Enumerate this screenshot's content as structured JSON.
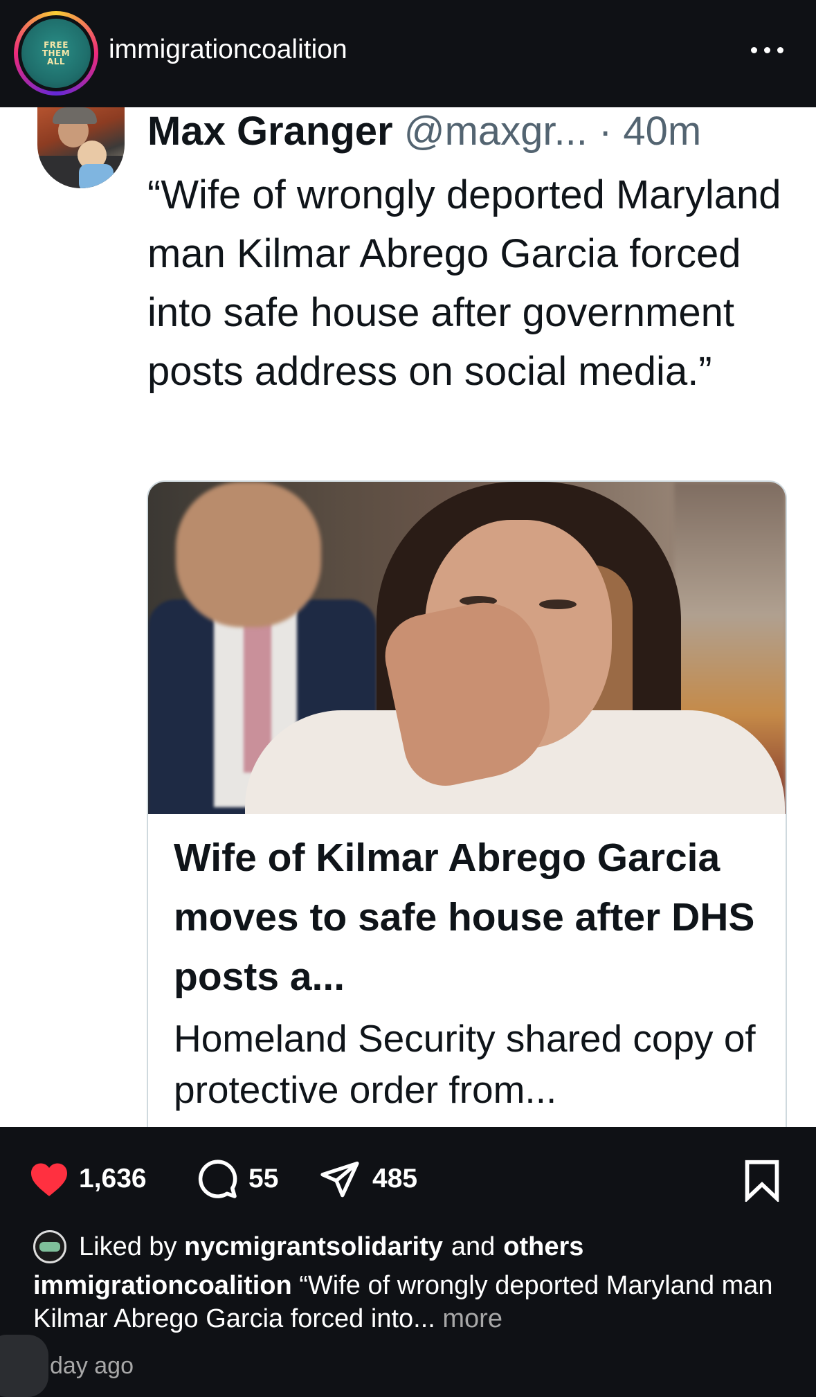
{
  "header": {
    "account_name": "immigrationcoalition",
    "avatar_text": [
      "FREE",
      "THEM",
      "ALL"
    ]
  },
  "tweet": {
    "author_name": "Max Granger",
    "author_handle": "@maxgr...",
    "separator": " · ",
    "time": "40m",
    "text": "“Wife of wrongly deported Maryland man Kilmar Abrego Garcia forced into safe house after government posts address on social media.”",
    "card": {
      "title": "Wife of Kilmar Abrego Garcia moves to safe house after DHS posts a...",
      "description": "Homeland Security shared copy of protective order from..."
    }
  },
  "actions": {
    "likes": "1,636",
    "comments": "55",
    "shares": "485"
  },
  "liked_by": {
    "prefix": "Liked by",
    "user": "nycmigrantsolidarity",
    "conjunction": "and",
    "others": "others"
  },
  "caption": {
    "username": "immigrationcoalition",
    "text": "“Wife of wrongly deported Maryland man Kilmar Abrego Garcia forced into...",
    "more": "more"
  },
  "timestamp": "day ago",
  "colors": {
    "like_red": "#ff3040",
    "background_dark": "#0f1115",
    "handle_gray": "#536471"
  }
}
